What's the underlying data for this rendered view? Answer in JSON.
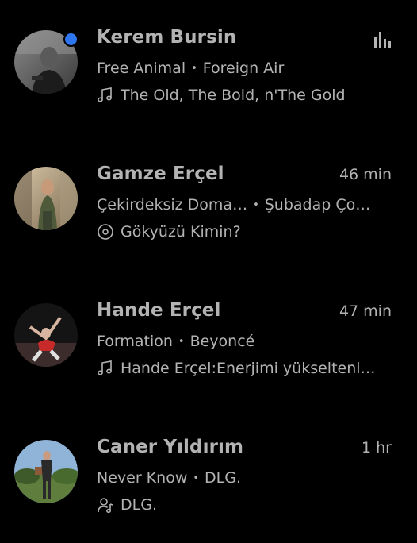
{
  "colors": {
    "background": "#000000",
    "text": "#b3b3b3",
    "online_indicator": "#2d76f0"
  },
  "friends": [
    {
      "name": "Kerem Bursin",
      "online": true,
      "status_icon": "now-playing-bars-icon",
      "time": "",
      "track": "Free Animal",
      "artist": "Foreign Air",
      "separator": "•",
      "context_icon": "music-note-icon",
      "context": "The Old, The Bold, n'The Gold"
    },
    {
      "name": "Gamze Erçel",
      "online": false,
      "time": "46 min",
      "track": "Çekirdeksiz Doma…",
      "artist": "Şubadap Ço…",
      "separator": "•",
      "context_icon": "album-disc-icon",
      "context": "Gökyüzü Kimin?"
    },
    {
      "name": "Hande Erçel",
      "online": false,
      "time": "47 min",
      "track": "Formation",
      "artist": "Beyoncé",
      "separator": "•",
      "context_icon": "music-note-icon",
      "context": "Hande Erçel:Enerjimi yükseltenl…"
    },
    {
      "name": "Caner Yıldırım",
      "online": false,
      "time": "1 hr",
      "track": "Never Know",
      "artist": "DLG.",
      "separator": "•",
      "context_icon": "artist-icon",
      "context": "DLG."
    }
  ]
}
